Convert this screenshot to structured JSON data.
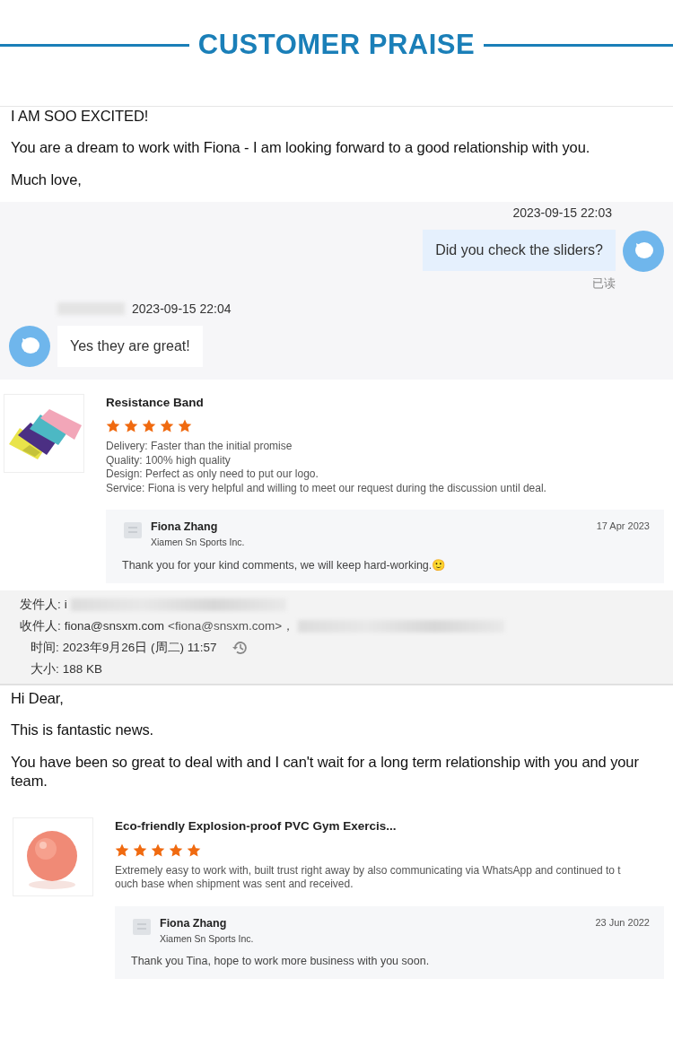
{
  "title": "CUSTOMER PRAISE",
  "sections": [
    {
      "kind": "message",
      "lines": [
        "I AM SOO EXCITED!",
        "You are a dream to work with Fiona - I am looking forward to a good relationship with you.",
        "Much love,"
      ]
    },
    {
      "kind": "chat",
      "messages": [
        {
          "kind": "outgoing",
          "time": "2023-09-15 22:03",
          "text": "Did you check the sliders?",
          "status": "已读"
        },
        {
          "kind": "incoming",
          "time": "2023-09-15 22:04",
          "text": "Yes they are great!"
        }
      ]
    },
    {
      "kind": "review",
      "image": {
        "kind": "picture"
      },
      "product": "Resistance Band",
      "stars": 5,
      "lines": [
        "Delivery: Faster than the initial promise",
        "Quality: 100% high quality",
        "Design: Perfect as only need to put our logo.",
        "Service: Fiona is very helpful and willing to meet our request during the discussion until deal."
      ],
      "reply": {
        "name": "Fiona Zhang",
        "company": "Xiamen Sn Sports Inc.",
        "date": "17 Apr 2023",
        "text": "Thank you for your kind comments, we will keep hard-working.🙂"
      }
    },
    {
      "kind": "email_header",
      "fields": [
        {
          "kind": "redacted",
          "label": "发件人:",
          "value": "i"
        },
        {
          "kind": "redacted",
          "label": "收件人:",
          "value": "fiona@snsxm.com",
          "extra": "<fiona@snsxm.com>，"
        },
        {
          "kind": "timestamp",
          "label": "时间:",
          "value": "2023年9月26日 (周二) 11:57"
        },
        {
          "kind": "plain",
          "label": "大小:",
          "value": "188 KB"
        }
      ]
    },
    {
      "kind": "message",
      "lines": [
        "Hi Dear,",
        "This is fantastic news.",
        "You have been so great to deal with and I can't wait for a long term relationship with you and your team."
      ]
    },
    {
      "kind": "review",
      "image": {
        "kind": "picture"
      },
      "product": "Eco-friendly Explosion-proof PVC Gym Exercis...",
      "stars": 5,
      "lines": [
        "Extremely easy to work with, built trust right away by also communicating via WhatsApp and continued to touch base when shipment was sent and received."
      ],
      "reply": {
        "name": "Fiona Zhang",
        "company": "Xiamen Sn Sports Inc.",
        "date": "23 Jun 2022",
        "text": "Thank you Tina, hope to work more business with you soon."
      }
    }
  ]
}
